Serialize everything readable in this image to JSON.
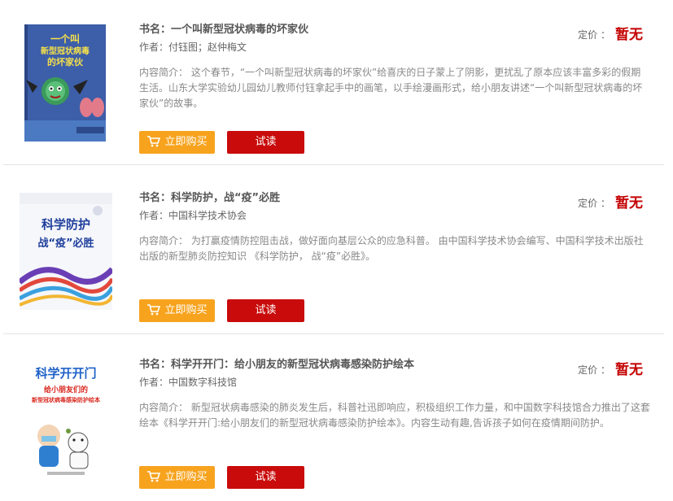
{
  "books": [
    {
      "title": "书名：一个叫新型冠状病毒的坏家伙",
      "author": "作者：付钰图；赵仲梅文",
      "intro": "内容简介： 这个春节，“一个叫新型冠状病毒的坏家伙”给喜庆的日子蒙上了阴影，更扰乱了原本应该丰富多彩的假期生活。山东大学实验幼儿园幼儿教师付钰拿起手中的画笔，以手绘漫画形式，给小朋友讲述“一个叫新型冠状病毒的坏家伙”的故事。",
      "price_label": "定价 ：",
      "price_value": "暂无",
      "buy_label": "立即购买",
      "read_label": "试读",
      "cover": {
        "text_lines": [
          "一个叫",
          "新型冠状病毒",
          "的坏家伙"
        ]
      }
    },
    {
      "title": "书名：科学防护，战“疫”必胜",
      "author": "作者：中国科学技术协会",
      "intro": "内容简介： 为打赢疫情防控阻击战，做好面向基层公众的应急科普。 由中国科学技术协会编写、中国科学技术出版社出版的新型肺炎防控知识 《科学防护， 战“疫”必胜》。",
      "price_label": "定价 ：",
      "price_value": "暂无",
      "buy_label": "立即购买",
      "read_label": "试读",
      "cover": {
        "text_lines": [
          "科学防护",
          "战“疫”必胜"
        ]
      }
    },
    {
      "title": "书名：科学开开门：给小朋友的新型冠状病毒感染防护绘本",
      "author": "作者：中国数字科技馆",
      "intro": "内容简介： 新型冠状病毒感染的肺炎发生后，科普社迅即响应，积极组织工作力量，和中国数字科技馆合力推出了这套绘本《科学开开门:给小朋友们的新型冠状病毒感染防护绘本》。内容生动有趣,告诉孩子如何在疫情期间防护。",
      "price_label": "定价 ：",
      "price_value": "暂无",
      "buy_label": "立即购买",
      "read_label": "试读",
      "cover": {
        "text_lines": [
          "科学开开门",
          "给小朋友们的",
          "新型冠状病毒感染防护绘本"
        ]
      }
    }
  ],
  "colors": {
    "buy": "#f7a31e",
    "read": "#c90b0b",
    "price": "#c40000"
  },
  "icons": {
    "cart": "shopping-cart-icon"
  }
}
